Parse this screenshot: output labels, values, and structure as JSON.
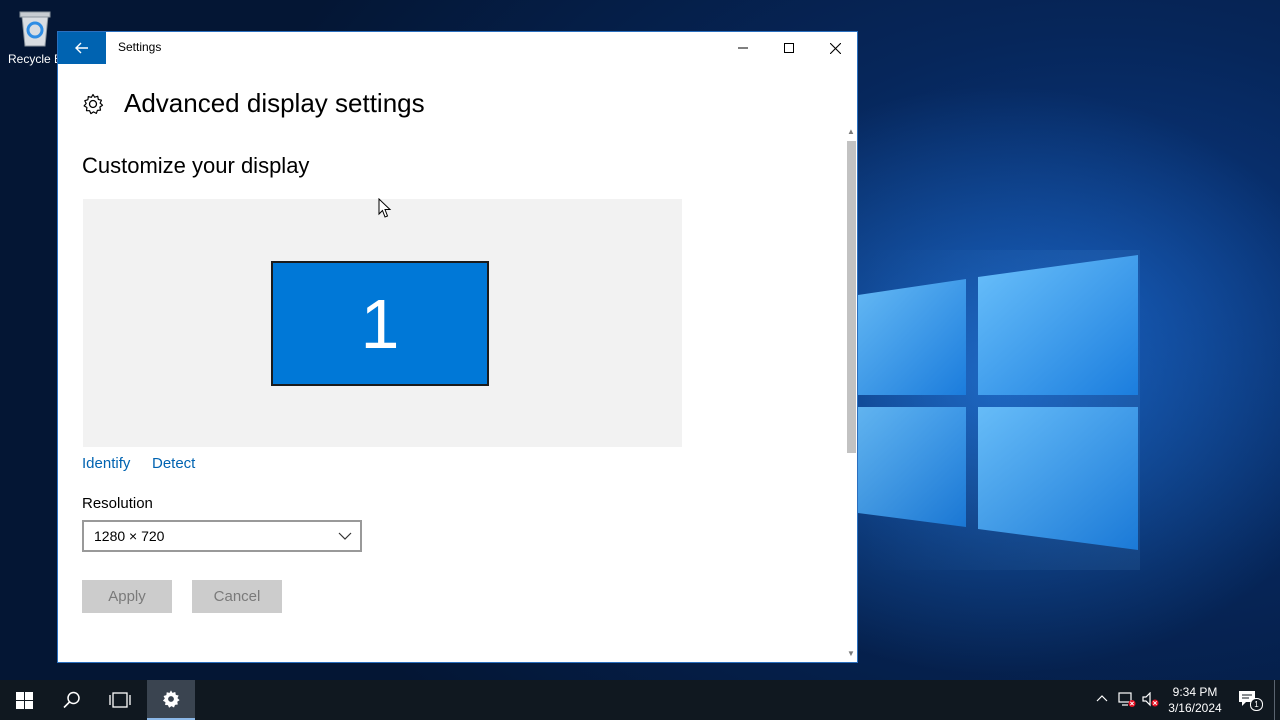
{
  "desktop": {
    "recycle_bin_label": "Recycle B"
  },
  "window": {
    "title": "Settings",
    "page_title": "Advanced display settings",
    "section_title": "Customize your display",
    "monitor_number": "1",
    "identify_label": "Identify",
    "detect_label": "Detect",
    "resolution_label": "Resolution",
    "resolution_value": "1280 × 720",
    "apply_label": "Apply",
    "cancel_label": "Cancel"
  },
  "taskbar": {
    "time": "9:34 PM",
    "date": "3/16/2024",
    "notification_count": "1"
  },
  "colors": {
    "accent": "#0063b1",
    "monitor": "#0078d7",
    "taskbar": "#101820"
  }
}
